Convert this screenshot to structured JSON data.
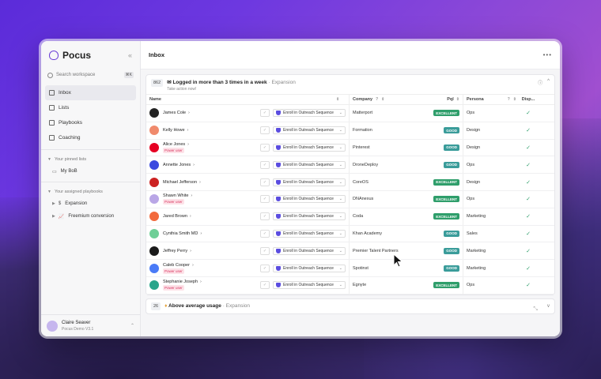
{
  "app": {
    "name": "Pocus",
    "collapse_icon": "«"
  },
  "search": {
    "placeholder": "Search workspace",
    "shortcut": "⌘K"
  },
  "nav": [
    {
      "label": "Inbox",
      "icon": "inbox-icon",
      "active": true
    },
    {
      "label": "Lists",
      "icon": "list-icon"
    },
    {
      "label": "Playbooks",
      "icon": "book-icon"
    },
    {
      "label": "Coaching",
      "icon": "coaching-icon"
    }
  ],
  "pinned": {
    "title": "Your pinned lists",
    "items": [
      {
        "label": "My BoB"
      }
    ]
  },
  "playbooks": {
    "title": "Your assigned playbooks",
    "items": [
      {
        "label": "Expansion",
        "symbol": "$"
      },
      {
        "label": "Freemium conversion",
        "symbol": "📈"
      }
    ]
  },
  "user": {
    "name": "Claire Seaver",
    "workspace": "Pocus Demo V3.1"
  },
  "header": {
    "title": "Inbox",
    "more": "•••"
  },
  "group1": {
    "count": "862",
    "title": "Logged in more than 3 times in a week",
    "tag": "Expansion",
    "subtitle": "Take action now!",
    "info_icon": "ⓘ",
    "toggle": "^"
  },
  "columns": {
    "name": "Name",
    "company": "Company",
    "pql": "Pql",
    "persona": "Persona",
    "display": "Disp..."
  },
  "enroll_label": "Enroll in Outreach Sequence",
  "power_label": "Power user",
  "rows": [
    {
      "name": "James Cole",
      "power": false,
      "company": "Matterport",
      "pql": "EXCELLENT",
      "persona": "Ops",
      "logo_color": "#222222"
    },
    {
      "name": "Kelly Howe",
      "power": false,
      "company": "Formation",
      "pql": "GOOD",
      "persona": "Design",
      "logo_color": "#f08a6c"
    },
    {
      "name": "Alice Jones",
      "power": true,
      "company": "Pinterest",
      "pql": "GOOD",
      "persona": "Design",
      "logo_color": "#e60023"
    },
    {
      "name": "Annette Jones",
      "power": false,
      "company": "DroneDeploy",
      "pql": "GOOD",
      "persona": "Ops",
      "logo_color": "#3b49df"
    },
    {
      "name": "Michael Jefferson",
      "power": false,
      "company": "CoreOS",
      "pql": "EXCELLENT",
      "persona": "Design",
      "logo_color": "#cc2222"
    },
    {
      "name": "Shawn White",
      "power": true,
      "company": "DNAnexus",
      "pql": "EXCELLENT",
      "persona": "Ops",
      "logo_color": "#b9a6e6"
    },
    {
      "name": "Jared Brown",
      "power": false,
      "company": "Coda",
      "pql": "EXCELLENT",
      "persona": "Marketing",
      "logo_color": "#f26a3d"
    },
    {
      "name": "Cynthia Smith MD",
      "power": false,
      "company": "Khan Academy",
      "pql": "GOOD",
      "persona": "Sales",
      "logo_color": "#6fcf97"
    },
    {
      "name": "Jeffrey Perry",
      "power": false,
      "company": "Premier Talent Partners",
      "pql": "GOOD",
      "persona": "Marketing",
      "logo_color": "#1a1a1a"
    },
    {
      "name": "Caleb Cooper",
      "power": true,
      "company": "Spotinst",
      "pql": "GOOD",
      "persona": "Marketing",
      "logo_color": "#4a7bf7"
    },
    {
      "name": "Stephanie Joseph",
      "power": true,
      "company": "Egnyte",
      "pql": "EXCELLENT",
      "persona": "Ops",
      "logo_color": "#2aa58b"
    }
  ],
  "group2": {
    "count": "26",
    "title": "Above average usage",
    "tag": "Expansion",
    "toggle": "v"
  },
  "colors": {
    "accent": "#6b3fd6",
    "excellent": "#2f9e6b",
    "good": "#3a9c9a",
    "power": "#d8345f"
  }
}
